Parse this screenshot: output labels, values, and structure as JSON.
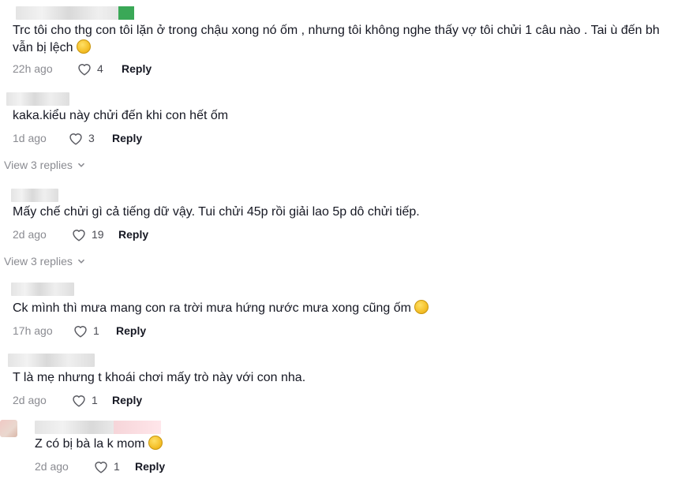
{
  "comments": [
    {
      "text": "Trc tôi cho thg con tôi lặn ở trong chậu xong nó ốm , nhưng tôi không nghe thấy vợ tôi chửi 1 câu nào . Tai ù đến bh vẫn bị lệch",
      "time": "22h ago",
      "likes": "4",
      "reply": "Reply",
      "emoji": "smiling-face-emoji"
    },
    {
      "text": "kaka.kiểu này chửi đến khi con hết ốm",
      "time": "1d ago",
      "likes": "3",
      "reply": "Reply",
      "view_replies": "View 3 replies"
    },
    {
      "text": "Mấy chế chửi gì cả tiếng dữ vậy. Tui chửi 45p rồi giải lao 5p dô chửi tiếp.",
      "time": "2d ago",
      "likes": "19",
      "reply": "Reply",
      "view_replies": "View 3 replies"
    },
    {
      "text": "Ck mình thì mưa mang con ra trời mưa hứng nước mưa xong cũng ốm",
      "time": "17h ago",
      "likes": "1",
      "reply": "Reply",
      "emoji": "pensive-face-emoji"
    },
    {
      "text": "T là mẹ nhưng t khoái chơi mấy trò này với con nha.",
      "time": "2d ago",
      "likes": "1",
      "reply": "Reply"
    },
    {
      "text": "Z có bị bà la k mom",
      "time": "2d ago",
      "likes": "1",
      "reply": "Reply",
      "emoji": "grinning-sweat-emoji"
    }
  ]
}
